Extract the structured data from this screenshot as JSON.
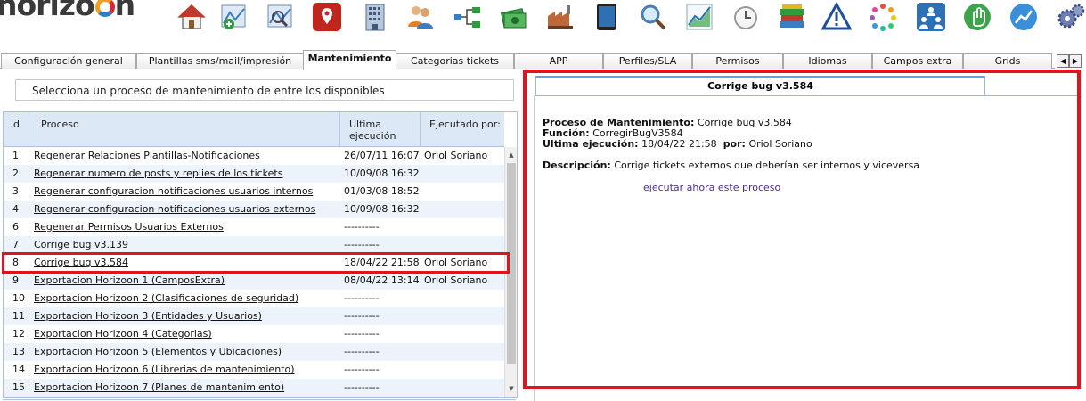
{
  "app": {
    "logo_text": "horizo",
    "logo_tail": "n"
  },
  "toolbar": {
    "icons": [
      {
        "name": "home-icon"
      },
      {
        "name": "map-add-icon"
      },
      {
        "name": "map-search-icon"
      },
      {
        "name": "location-pin-icon"
      },
      {
        "name": "building-icon"
      },
      {
        "name": "users-icon"
      },
      {
        "name": "hierarchy-icon"
      },
      {
        "name": "money-icon"
      },
      {
        "name": "factory-icon"
      },
      {
        "name": "tablet-icon"
      },
      {
        "name": "magnifier-icon"
      },
      {
        "name": "chart-growth-icon"
      },
      {
        "name": "clock-icon"
      },
      {
        "name": "books-icon"
      },
      {
        "name": "warning-icon"
      },
      {
        "name": "loading-dots-icon"
      },
      {
        "name": "org-chart-icon"
      },
      {
        "name": "hand-icon"
      },
      {
        "name": "trend-chart-icon"
      },
      {
        "name": "gears-icon"
      }
    ]
  },
  "tabs": [
    {
      "label": "Configuración general"
    },
    {
      "label": "Plantillas sms/mail/impresión"
    },
    {
      "label": "Mantenimiento"
    },
    {
      "label": "Categorias tickets"
    },
    {
      "label": "APP"
    },
    {
      "label": "Perfiles/SLA"
    },
    {
      "label": "Permisos"
    },
    {
      "label": "Idiomas"
    },
    {
      "label": "Campos extra"
    },
    {
      "label": "Grids"
    }
  ],
  "hint": "Selecciona un proceso de mantenimiento de entre los disponibles",
  "grid": {
    "headers": {
      "id": "id",
      "process": "Proceso",
      "last_run": "Ultima ejecución",
      "run_by": "Ejecutado por:"
    },
    "rows": [
      {
        "id": "1",
        "process": "Regenerar Relaciones Plantillas-Notificaciones",
        "date": "26/07/11 16:07",
        "by": "Oriol Soriano"
      },
      {
        "id": "2",
        "process": "Regenerar numero de posts y replies de los tickets",
        "date": "10/09/08 16:32",
        "by": ""
      },
      {
        "id": "3",
        "process": "Regenerar configuracion notificaciones usuarios internos",
        "date": "01/03/08 18:52",
        "by": ""
      },
      {
        "id": "4",
        "process": "Regenerar configuracion notificaciones usuarios externos",
        "date": "10/09/08 16:32",
        "by": ""
      },
      {
        "id": "6",
        "process": "Regenerar Permisos Usuarios Externos",
        "date": "----------",
        "by": ""
      },
      {
        "id": "7",
        "process": "Corrige bug v3.139",
        "date": "----------",
        "by": ""
      },
      {
        "id": "8",
        "process": "Corrige bug v3.584",
        "date": "18/04/22 21:58",
        "by": "Oriol Soriano"
      },
      {
        "id": "9",
        "process": "Exportacion Horizoon 1 (CamposExtra)",
        "date": "08/04/22 13:14",
        "by": "Oriol Soriano"
      },
      {
        "id": "10",
        "process": "Exportacion Horizoon 2 (Clasificaciones de seguridad)",
        "date": "----------",
        "by": ""
      },
      {
        "id": "11",
        "process": "Exportacion Horizoon 3 (Entidades y Usuarios)",
        "date": "----------",
        "by": ""
      },
      {
        "id": "12",
        "process": "Exportacion Horizoon 4 (Categorias)",
        "date": "----------",
        "by": ""
      },
      {
        "id": "13",
        "process": "Exportacion Horizoon 5 (Elementos y Ubicaciones)",
        "date": "----------",
        "by": ""
      },
      {
        "id": "14",
        "process": "Exportacion Horizoon 6 (Librerias de mantenimiento)",
        "date": "----------",
        "by": ""
      },
      {
        "id": "15",
        "process": "Exportacion Horizoon 7 (Planes de mantenimiento)",
        "date": "----------",
        "by": ""
      }
    ]
  },
  "detail": {
    "tab_title": "Corrige bug v3.584",
    "process_label": "Proceso de Mantenimiento:",
    "process_value": "Corrige bug v3.584",
    "function_label": "Función:",
    "function_value": "CorregirBugV3584",
    "last_run_label": "Ultima ejecución:",
    "last_run_value": "18/04/22 21:58",
    "by_label": "por:",
    "by_value": "Oriol Soriano",
    "desc_label": "Descripción:",
    "desc_value": "Corrige tickets externos que deberían ser internos y viceversa",
    "run_link": "ejecutar ahora este proceso"
  },
  "colors": {
    "highlight_red": "#e0141e",
    "grid_header": "#dce8f6",
    "grid_alt_row": "#edf3fb",
    "link_purple": "#4a2f8a"
  }
}
